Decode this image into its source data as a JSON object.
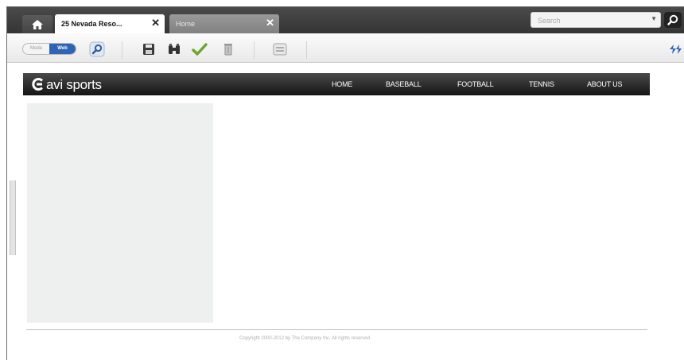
{
  "browser": {
    "tabs": [
      {
        "label": "25 Nevada Reso...",
        "active": true
      },
      {
        "label": "Home",
        "active": false
      }
    ],
    "search": {
      "placeholder": "Search",
      "value": ""
    }
  },
  "toolbar": {
    "mode_toggle": {
      "off_label": "Mode",
      "on_label": "Web"
    },
    "icons": [
      "preview-icon",
      "save-icon",
      "find-icon",
      "approve-check-icon",
      "delete-trash-icon",
      "layout-icon",
      "sync-icon"
    ]
  },
  "site": {
    "logo": "avi sports",
    "nav": [
      "HOME",
      "BASEBALL",
      "FOOTBALL",
      "TENNIS",
      "ABOUT US"
    ],
    "footer": "Copyright 2000-2012 by The Company Inc. All rights reserved."
  },
  "colors": {
    "browser_chrome": "#3d3d3d",
    "toggle_active": "#2f63b5",
    "site_header": "#2a2a2a",
    "sidebar_panel": "#eef0ef"
  }
}
